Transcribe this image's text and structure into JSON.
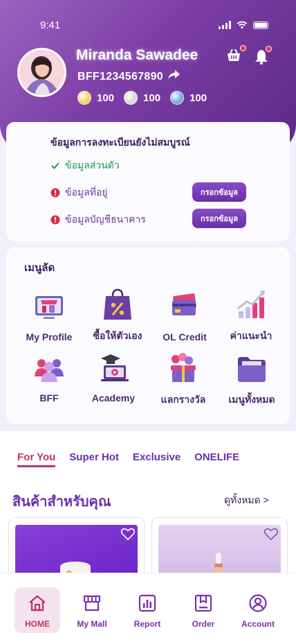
{
  "status_bar": {
    "time": "9:41"
  },
  "profile": {
    "name": "Miranda Sawadee",
    "member_id": "BFF1234567890",
    "coins": [
      {
        "icon": "gold-coin-icon",
        "value": "100",
        "color": "#f1d46b"
      },
      {
        "icon": "silver-coin-icon",
        "value": "100",
        "color": "#d9d9d9"
      },
      {
        "icon": "blue-coin-icon",
        "value": "100",
        "color": "#7aa8e8"
      }
    ]
  },
  "header_icons": {
    "cart": "basket-icon",
    "notifications": "bell-icon"
  },
  "registration": {
    "title": "ข้อมูลการลงทะเบียนยังไม่สมบูรณ์",
    "items": [
      {
        "label": "ข้อมูลส่วนตัว",
        "status": "complete"
      },
      {
        "label": "ข้อมูลที่อยู่",
        "status": "incomplete",
        "button": "กรอกข้อมูล"
      },
      {
        "label": "ข้อมูลบัญชีธนาคาร",
        "status": "incomplete",
        "button": "กรอกข้อมูล"
      }
    ]
  },
  "shortcut_menu": {
    "title": "เมนูลัด",
    "items": [
      {
        "label": "My Profile",
        "icon": "profile-shop-icon"
      },
      {
        "label": "ซื้อให้ตัวเอง",
        "icon": "shopping-bag-percent-icon"
      },
      {
        "label": "OL Credit",
        "icon": "credit-cards-icon"
      },
      {
        "label": "ค่าแนะนำ",
        "icon": "growth-chart-icon"
      },
      {
        "label": "BFF",
        "icon": "people-group-icon"
      },
      {
        "label": "Academy",
        "icon": "graduation-laptop-icon"
      },
      {
        "label": "แลกรางวัล",
        "icon": "gift-balloons-icon"
      },
      {
        "label": "เมนูทั้งหมด",
        "icon": "folder-icon"
      }
    ]
  },
  "tabs": [
    {
      "label": "For You",
      "active": true
    },
    {
      "label": "Super Hot",
      "active": false
    },
    {
      "label": "Exclusive",
      "active": false
    },
    {
      "label": "ONELIFE",
      "active": false
    }
  ],
  "products_section": {
    "title": "สินค้าสำหรับคุณ",
    "see_all": "ดูทั้งหมด >"
  },
  "bottom_nav": [
    {
      "label": "HOME",
      "icon": "home-icon",
      "active": true
    },
    {
      "label": "My Mall",
      "icon": "store-icon",
      "active": false
    },
    {
      "label": "Report",
      "icon": "report-icon",
      "active": false
    },
    {
      "label": "Order",
      "icon": "order-icon",
      "active": false
    },
    {
      "label": "Account",
      "icon": "account-icon",
      "active": false
    }
  ],
  "colors": {
    "primary": "#6b2fae",
    "accent": "#c2335f",
    "header_start": "#9c62c0",
    "header_end": "#5b2a86"
  }
}
